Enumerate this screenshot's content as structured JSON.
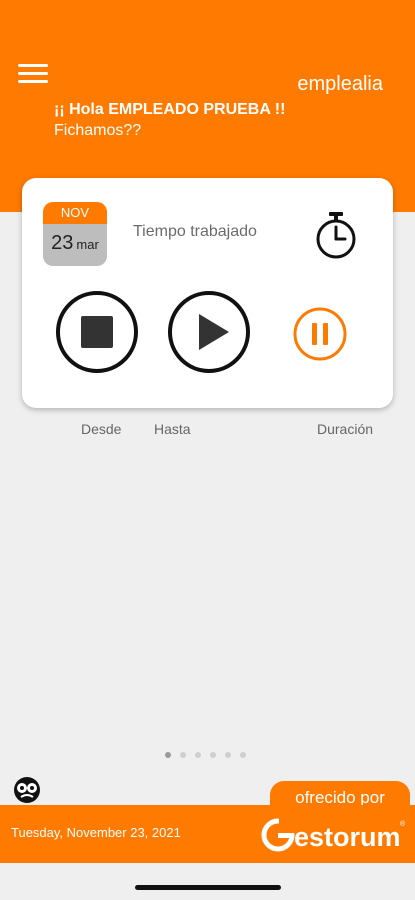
{
  "header": {
    "brand": "emplealia",
    "greeting": "¡¡ Hola EMPLEADO PRUEBA !!",
    "subgreeting": "Fichamos??"
  },
  "card": {
    "calendar": {
      "month": "NOV",
      "day": "23",
      "weekday": "mar"
    },
    "worked_label": "Tiempo trabajado"
  },
  "columns": {
    "desde": "Desde",
    "hasta": "Hasta",
    "duracion": "Duración"
  },
  "pager": {
    "pages": 6,
    "active": 0
  },
  "footer": {
    "offered_by": "ofrecido por",
    "date": "Tuesday, November 23, 2021",
    "logo": "Gestorum"
  },
  "colors": {
    "accent": "#ff7a00",
    "background": "#efefef"
  },
  "icons": [
    "menu-icon",
    "stopwatch-icon",
    "stop-icon",
    "play-icon",
    "pause-icon",
    "faces-icon"
  ]
}
